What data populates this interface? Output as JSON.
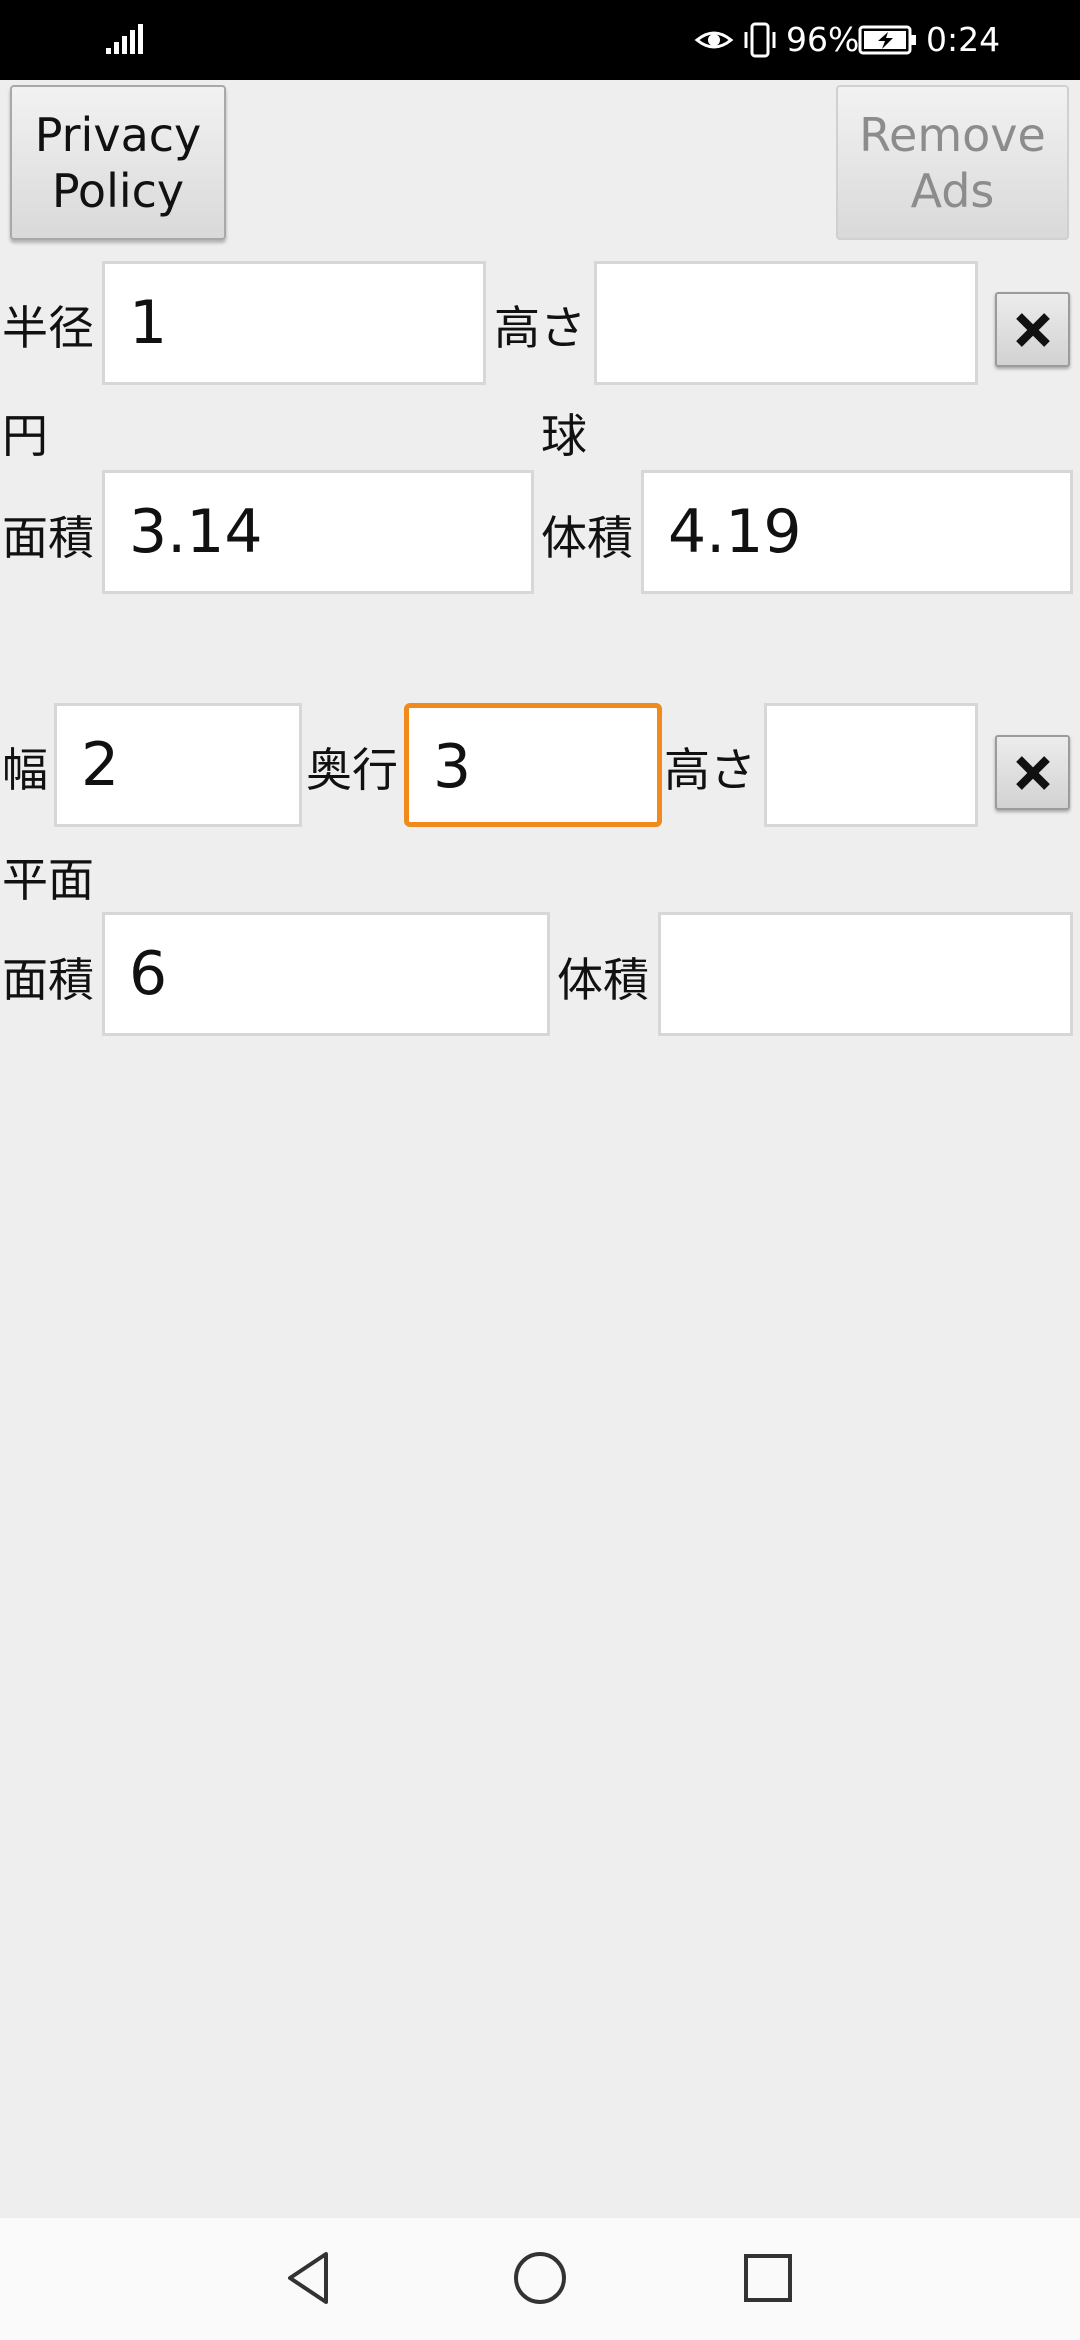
{
  "status_bar": {
    "battery": "96%",
    "time": "0:24"
  },
  "buttons": {
    "privacy_policy": "Privacy\nPolicy",
    "remove_ads": "Remove\nAds"
  },
  "circle_section": {
    "radius_label": "半径",
    "radius_value": "1",
    "height_label": "高さ",
    "height_value": "",
    "circle_label": "円",
    "sphere_label": "球",
    "area_label": "面積",
    "area_value": "3.14",
    "volume_label": "体積",
    "volume_value": "4.19"
  },
  "box_section": {
    "width_label": "幅",
    "width_value": "2",
    "depth_label": "奥行",
    "depth_value": "3",
    "height_label": "高さ",
    "height_value": "",
    "plane_label": "平面",
    "area_label": "面積",
    "area_value": "6",
    "volume_label": "体積",
    "volume_value": ""
  },
  "nav_bar": {
    "back_icon": "back-triangle",
    "home_icon": "home-circle",
    "recents_icon": "recents-square"
  }
}
